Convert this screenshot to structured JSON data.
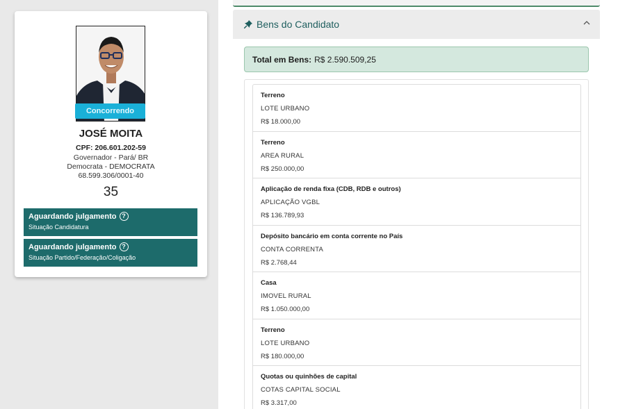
{
  "candidate": {
    "status_label": "Concorrendo",
    "name": "JOSÉ MOITA",
    "cpf": "CPF: 206.601.202-59",
    "office": "Governador - Pará/ BR",
    "party": "Democrata - DEMOCRATA",
    "cnpj": "68.599.306/0001-40",
    "number": "35",
    "situations": [
      {
        "title": "Aguardando julgamento",
        "subtitle": "Situação Candidatura"
      },
      {
        "title": "Aguardando julgamento",
        "subtitle": "Situação Partido/Federação/Coligação"
      }
    ]
  },
  "bens": {
    "title": "Bens do Candidato",
    "total_label": "Total em Bens:",
    "total_value": "R$ 2.590.509,25",
    "items": [
      {
        "type": "Terreno",
        "description": "LOTE URBANO",
        "value": "R$ 18.000,00"
      },
      {
        "type": "Terreno",
        "description": "AREA RURAL",
        "value": "R$ 250.000,00"
      },
      {
        "type": "Aplicação de renda fixa (CDB, RDB e outros)",
        "description": "APLICAÇÃO VGBL",
        "value": "R$ 136.789,93"
      },
      {
        "type": "Depósito bancário em conta corrente no País",
        "description": "CONTA CORRENTA",
        "value": "R$ 2.768,44"
      },
      {
        "type": "Casa",
        "description": "IMOVEL RURAL",
        "value": "R$ 1.050.000,00"
      },
      {
        "type": "Terreno",
        "description": "LOTE URBANO",
        "value": "R$ 180.000,00"
      },
      {
        "type": "Quotas ou quinhões de capital",
        "description": "COTAS CAPITAL SOCIAL",
        "value": "R$ 3.317,00"
      }
    ]
  },
  "colors": {
    "status_pill": "#1ab0d8",
    "situation_bg": "#1d6b6b",
    "total_bg": "#d4e8de",
    "accent": "#1e5e5e"
  },
  "icons": [
    "pin-icon",
    "chevron-up-icon",
    "help-icon"
  ]
}
